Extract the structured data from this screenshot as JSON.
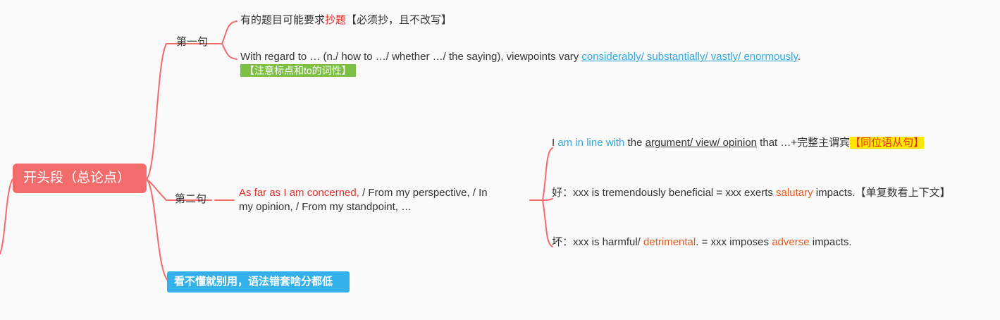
{
  "root": {
    "label": "开头段（总论点）"
  },
  "sentence1": {
    "label": "第一句",
    "item1": {
      "prefix": "有的题目可能要求",
      "highlight": "抄题",
      "suffix": "【必须抄，且不改写】"
    },
    "item2": {
      "prefix": "With regard to … (n./ how to …/ whether …/ the saying), viewpoints vary ",
      "link": "considerably/ substantially/ vastly/ enormously",
      "suffix": ".",
      "tag": "【注意标点和to的词性】"
    }
  },
  "sentence2": {
    "label": "第二句",
    "main": {
      "highlight": "As far as I am concerned,",
      "line1_rest": " / From my perspective, / In",
      "line2": "my opinion, / From my standpoint, …"
    },
    "children": {
      "c1": {
        "p1": "I ",
        "blue": "am in line with",
        "p2": " the ",
        "under": "argument/ view/ opinion",
        "p3": " that …+完整主谓宾",
        "tag": "【同位语从句】"
      },
      "c2": {
        "p1": "好：xxx is tremendously beneficial = xxx exerts ",
        "orange": "salutary",
        "p2": " impacts.【单复数看上下文】"
      },
      "c3": {
        "p1": "坏：xxx is harmful/ ",
        "orange": "detrimental",
        "p2": ". = xxx imposes ",
        "orange2": "adverse",
        "p3": " impacts."
      }
    }
  },
  "note": {
    "label": "看不懂就别用，语法错套啥分都低"
  },
  "colors": {
    "branch_line": "#f36c6c",
    "root_bg": "#f36c6c",
    "note_bg": "#34b1e8",
    "green_tag": "#7cbf42",
    "yellow_tag": "#ffe600"
  }
}
